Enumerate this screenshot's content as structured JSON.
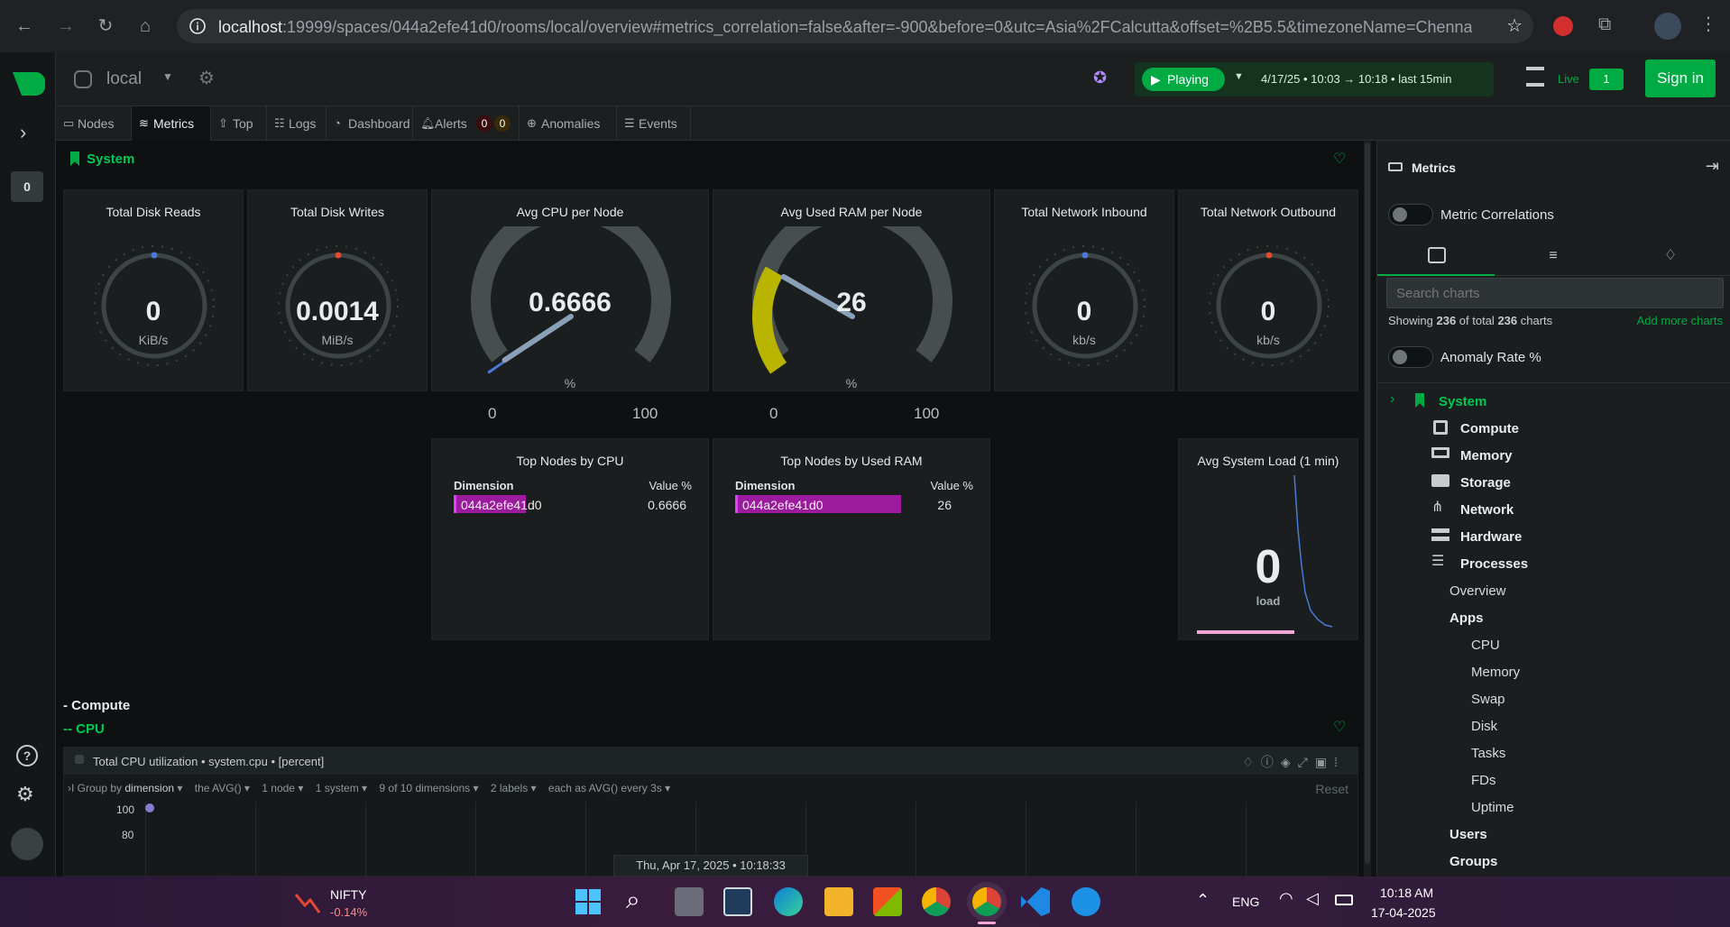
{
  "browser": {
    "url_host": "localhost",
    "url_rest": ":19999/spaces/044a2efe41d0/rooms/local/overview#metrics_correlation=false&after=-900&before=0&utc=Asia%2FCalcutta&offset=%2B5.5&timezoneName=Chennai%2..."
  },
  "topbar": {
    "room": "local",
    "playing": "Playing",
    "timerange": "4/17/25 • 10:03 → 10:18 • last 15min",
    "live": "Live",
    "live_count": "1",
    "signin": "Sign in"
  },
  "rail": {
    "badge": "0"
  },
  "tabs": [
    {
      "label": "Nodes"
    },
    {
      "label": "Metrics"
    },
    {
      "label": "Top"
    },
    {
      "label": "Logs"
    },
    {
      "label": "Dashboard"
    },
    {
      "label": "Alerts"
    },
    {
      "label": "Anomalies"
    },
    {
      "label": "Events"
    }
  ],
  "alerts_counts": [
    "0",
    "0"
  ],
  "section": {
    "system": "System",
    "compute": "- Compute",
    "cpu": "-- CPU"
  },
  "gauges": [
    {
      "title": "Total Disk Reads",
      "value": "0",
      "unit": "KiB/s"
    },
    {
      "title": "Total Disk Writes",
      "value": "0.0014",
      "unit": "MiB/s"
    },
    {
      "title": "Avg CPU per Node",
      "value": "0.6666",
      "unit": "%",
      "min": "0",
      "max": "100",
      "fraction": 0.006666
    },
    {
      "title": "Avg Used RAM per Node",
      "value": "26",
      "unit": "%",
      "min": "0",
      "max": "100",
      "fraction": 0.26
    },
    {
      "title": "Total Network Inbound",
      "value": "0",
      "unit": "kb/s"
    },
    {
      "title": "Total Network Outbound",
      "value": "0",
      "unit": "kb/s"
    }
  ],
  "top_cpu": {
    "title": "Top Nodes by CPU",
    "col1": "Dimension",
    "col2": "Value %",
    "row": {
      "name": "044a2efe41d0",
      "value": "0.6666",
      "fraction": 0.45
    }
  },
  "top_ram": {
    "title": "Top Nodes by Used RAM",
    "col1": "Dimension",
    "col2": "Value %",
    "row": {
      "name": "044a2efe41d0",
      "value": "26",
      "fraction": 1.0
    }
  },
  "load": {
    "title": "Avg System Load (1 min)",
    "value": "0",
    "unit": "load"
  },
  "cpu_chart": {
    "title": "Total CPU utilization • system.cpu • [percent]",
    "group_by": "Group by",
    "group_val": "dimension",
    "agg": "the AVG()",
    "nodes": "1 node",
    "systems": "1 system",
    "dims": "9 of 10 dimensions",
    "labels": "2 labels",
    "each": "each as AVG() every 3s",
    "reset": "Reset",
    "y_ticks": [
      "100",
      "80"
    ],
    "timestamp": "Thu, Apr 17, 2025 • 10:18:33"
  },
  "rpanel": {
    "title": "Metrics",
    "metric_corr": "Metric Correlations",
    "search_placeholder": "Search charts",
    "showing_pre": "Showing ",
    "showing_n": "236",
    "showing_mid": " of total ",
    "showing_total": "236",
    "showing_post": " charts",
    "add_more": "Add more charts",
    "anomaly": "Anomaly Rate %",
    "tree": {
      "system": "System",
      "compute": "Compute",
      "memory": "Memory",
      "storage": "Storage",
      "network": "Network",
      "hardware": "Hardware",
      "processes": "Processes",
      "overview": "Overview",
      "apps": "Apps",
      "cpu": "CPU",
      "mem": "Memory",
      "swap": "Swap",
      "disk": "Disk",
      "tasks": "Tasks",
      "fds": "FDs",
      "uptime": "Uptime",
      "users": "Users",
      "groups": "Groups"
    }
  },
  "taskbar": {
    "ticker": "NIFTY",
    "change": "-0.14%",
    "lang": "ENG",
    "time": "10:18 AM",
    "date": "17-04-2025"
  }
}
